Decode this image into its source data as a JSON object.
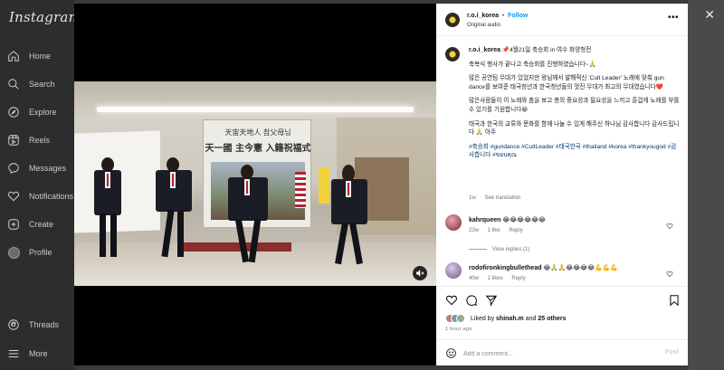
{
  "app": {
    "logo": "Instagram"
  },
  "sidebar": {
    "items": [
      {
        "label": "Home",
        "icon": "home-icon"
      },
      {
        "label": "Search",
        "icon": "search-icon"
      },
      {
        "label": "Explore",
        "icon": "explore-icon"
      },
      {
        "label": "Reels",
        "icon": "reels-icon"
      },
      {
        "label": "Messages",
        "icon": "messages-icon"
      },
      {
        "label": "Notifications",
        "icon": "heart-icon"
      },
      {
        "label": "Create",
        "icon": "plus-icon"
      },
      {
        "label": "Profile",
        "icon": "avatar-icon"
      }
    ],
    "bottom": [
      {
        "label": "Threads",
        "icon": "threads-icon"
      },
      {
        "label": "More",
        "icon": "menu-icon"
      }
    ]
  },
  "video": {
    "banner_line1": "天宙天地人 참父母님",
    "banner_line2": "天一國 主今憲 入籍祝福式"
  },
  "post": {
    "username": "r.o.i_korea",
    "dot": "•",
    "follow": "Follow",
    "audio": "Original audio",
    "more": "•••",
    "caption": {
      "user": "r.o.i_korea",
      "line1": "📌4월21일 축승회 in 여수 화양청전",
      "p1": "축복식 행사가 끝나고 축승회를 진행하였습니다~🙏",
      "p2": "많은 공연팀 무대가 있었지만 왕님께서 발해적신 'Cult Leader' 노래에 맞춰 gun dance를 보여준 태국청년과 한국청년들의 멋진 무대가 최고의 무대였습니다❤️",
      "p3": "많은사람들이 이 노래와 춤을 보고 총의 중요성과 필요성을 느끼고 즐겁게 노래를 부를 수 있기를 기원합니다😁",
      "p4": "태국과 한국의 교류와 문화를 함께 나눌 수 있게 해주신 하나님 감사합니다 감사드립니다 🙏 아주",
      "tags": "#축승회 #gundance #CultLeader #태국한국 #thailand #korea #thankyougod #감사합니다 #ขอบคุณ",
      "time": "1w",
      "see_translation": "See translation"
    },
    "comments": [
      {
        "user": "kahrqueen",
        "text": "😂😂😂😂😂😂",
        "time": "22w",
        "likes": "1 like",
        "reply": "Reply"
      },
      {
        "user": "rodofironkingbullethead",
        "text": "😂🙏🙏😂😂😂😂💪💪💪",
        "time": "40w",
        "likes": "2 likes",
        "reply": "Reply"
      }
    ],
    "view_replies": "View replies (1)",
    "liked_by_prefix": "Liked by",
    "liked_by_user": "shinah.m",
    "liked_by_and": "and",
    "liked_by_others": "25 others",
    "posted": "1 hour ago",
    "add_comment_placeholder": "Add a comment...",
    "post_label": "Post"
  },
  "colors": {
    "follow": "#0095f6",
    "panel_bg": "#ffffff",
    "overlay": "#3a3a3a"
  }
}
